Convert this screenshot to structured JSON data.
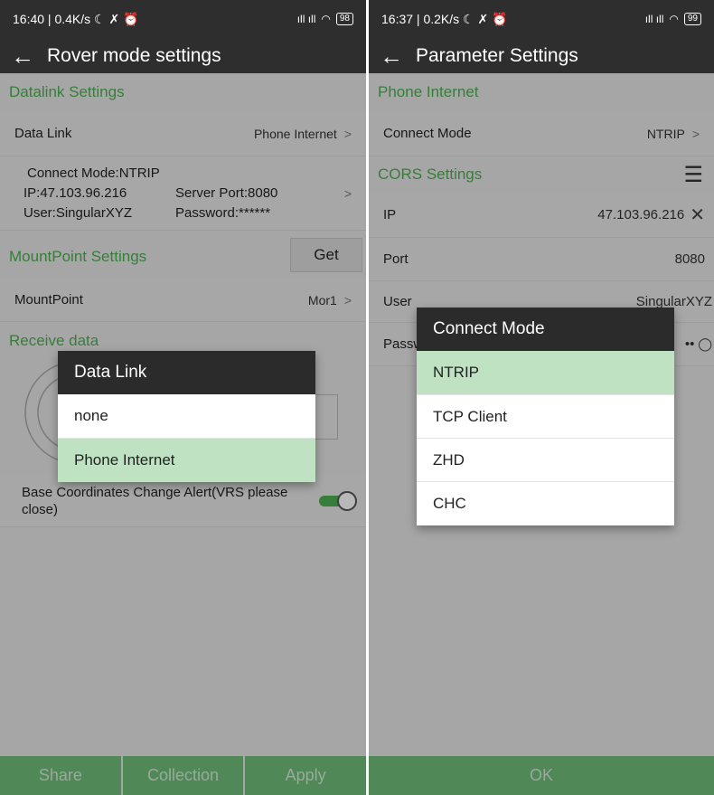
{
  "left": {
    "status": {
      "time": "16:40 | 0.4K/s",
      "glyphs": "☾ ✗ ⏰",
      "signal": "ıll ıll",
      "battery": "98"
    },
    "title": "Rover mode settings",
    "datalink_section": "Datalink Settings",
    "data_link_label": "Data Link",
    "data_link_value": "Phone Internet",
    "connect_mode": "Connect Mode:NTRIP",
    "ip": "IP:47.103.96.216",
    "server_port": "Server Port:8080",
    "user": "User:SingularXYZ",
    "password": "Password:******",
    "mountpoint_section": "MountPoint Settings",
    "get_label": "Get",
    "mountpoint_label": "MountPoint",
    "mountpoint_value": "Mor1",
    "receive_section": "Receive data",
    "base_alert": "Base Coordinates Change Alert(VRS please close)",
    "buttons": [
      "Share",
      "Collection",
      "Apply"
    ],
    "dialog": {
      "title": "Data Link",
      "options": [
        "none",
        "Phone Internet"
      ],
      "selected": "Phone Internet"
    }
  },
  "right": {
    "status": {
      "time": "16:37 | 0.2K/s",
      "glyphs": "☾ ✗ ⏰",
      "signal": "ıll ıll",
      "battery": "99"
    },
    "title": "Parameter Settings",
    "phone_section": "Phone Internet",
    "connect_mode_label": "Connect Mode",
    "connect_mode_value": "NTRIP",
    "cors_section": "CORS Settings",
    "ip_label": "IP",
    "ip_value": "47.103.96.216",
    "port_label": "Port",
    "port_value": "8080",
    "user_label": "User",
    "user_value": "SingularXYZ",
    "password_label": "Passw",
    "password_value": "••",
    "ok_label": "OK",
    "dialog": {
      "title": "Connect Mode",
      "options": [
        "NTRIP",
        "TCP Client",
        "ZHD",
        "CHC"
      ],
      "selected": "NTRIP"
    }
  },
  "colors": {
    "accent": "#4caf50",
    "bar": "#2e2e2e",
    "selected": "#bfe3c2",
    "button": "#6fbe79"
  },
  "icons": [
    "back-arrow-icon",
    "chevron-right-icon",
    "list-menu-icon",
    "clear-x-icon",
    "eye-icon",
    "toggle-switch"
  ]
}
